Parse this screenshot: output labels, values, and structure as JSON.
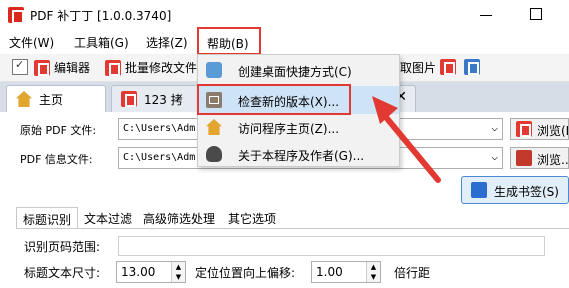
{
  "window": {
    "title": "PDF 补丁丁 [1.0.0.3740]"
  },
  "menubar": {
    "file": "文件(W)",
    "tools": "工具箱(G)",
    "select": "选择(Z)",
    "help": "帮助(B)"
  },
  "toolbar": {
    "editor": "编辑器",
    "batch": "批量修改文件",
    "image": "取图片"
  },
  "tabs": [
    {
      "label": "主页"
    },
    {
      "label": "123 拷"
    }
  ],
  "form": {
    "source_label": "原始 PDF 文件:",
    "source_value": "C:\\Users\\Adm",
    "info_label": "PDF 信息文件:",
    "info_value": "C:\\Users\\Adm",
    "browse1": "浏览(L",
    "browse2": "浏览..",
    "generate": "生成书签(S)"
  },
  "subtabs": {
    "tab1": "标题识别",
    "tab2": "文本过滤",
    "tab3": "高级筛选处理",
    "tab4": "其它选项"
  },
  "fields": {
    "page_range_label": "识别页码范围:",
    "font_size_label": "标题文本尺寸:",
    "font_size_value": "13.00",
    "offset_label": "定位位置向上偏移:",
    "offset_value": "1.00",
    "line_unit": "倍行距"
  },
  "help_menu": {
    "items": [
      {
        "label": "创建桌面快捷方式(C)",
        "icon": "shortcut-icon"
      },
      {
        "label": "检查新的版本(X)...",
        "icon": "update-icon"
      },
      {
        "label": "访问程序主页(Z)...",
        "icon": "home-icon"
      },
      {
        "label": "关于本程序及作者(G)...",
        "icon": "person-icon"
      }
    ]
  },
  "colors": {
    "annotation_red": "#e23a33",
    "menu_highlight": "#cfe3f7",
    "tabbar_bg": "#d6dde6"
  }
}
